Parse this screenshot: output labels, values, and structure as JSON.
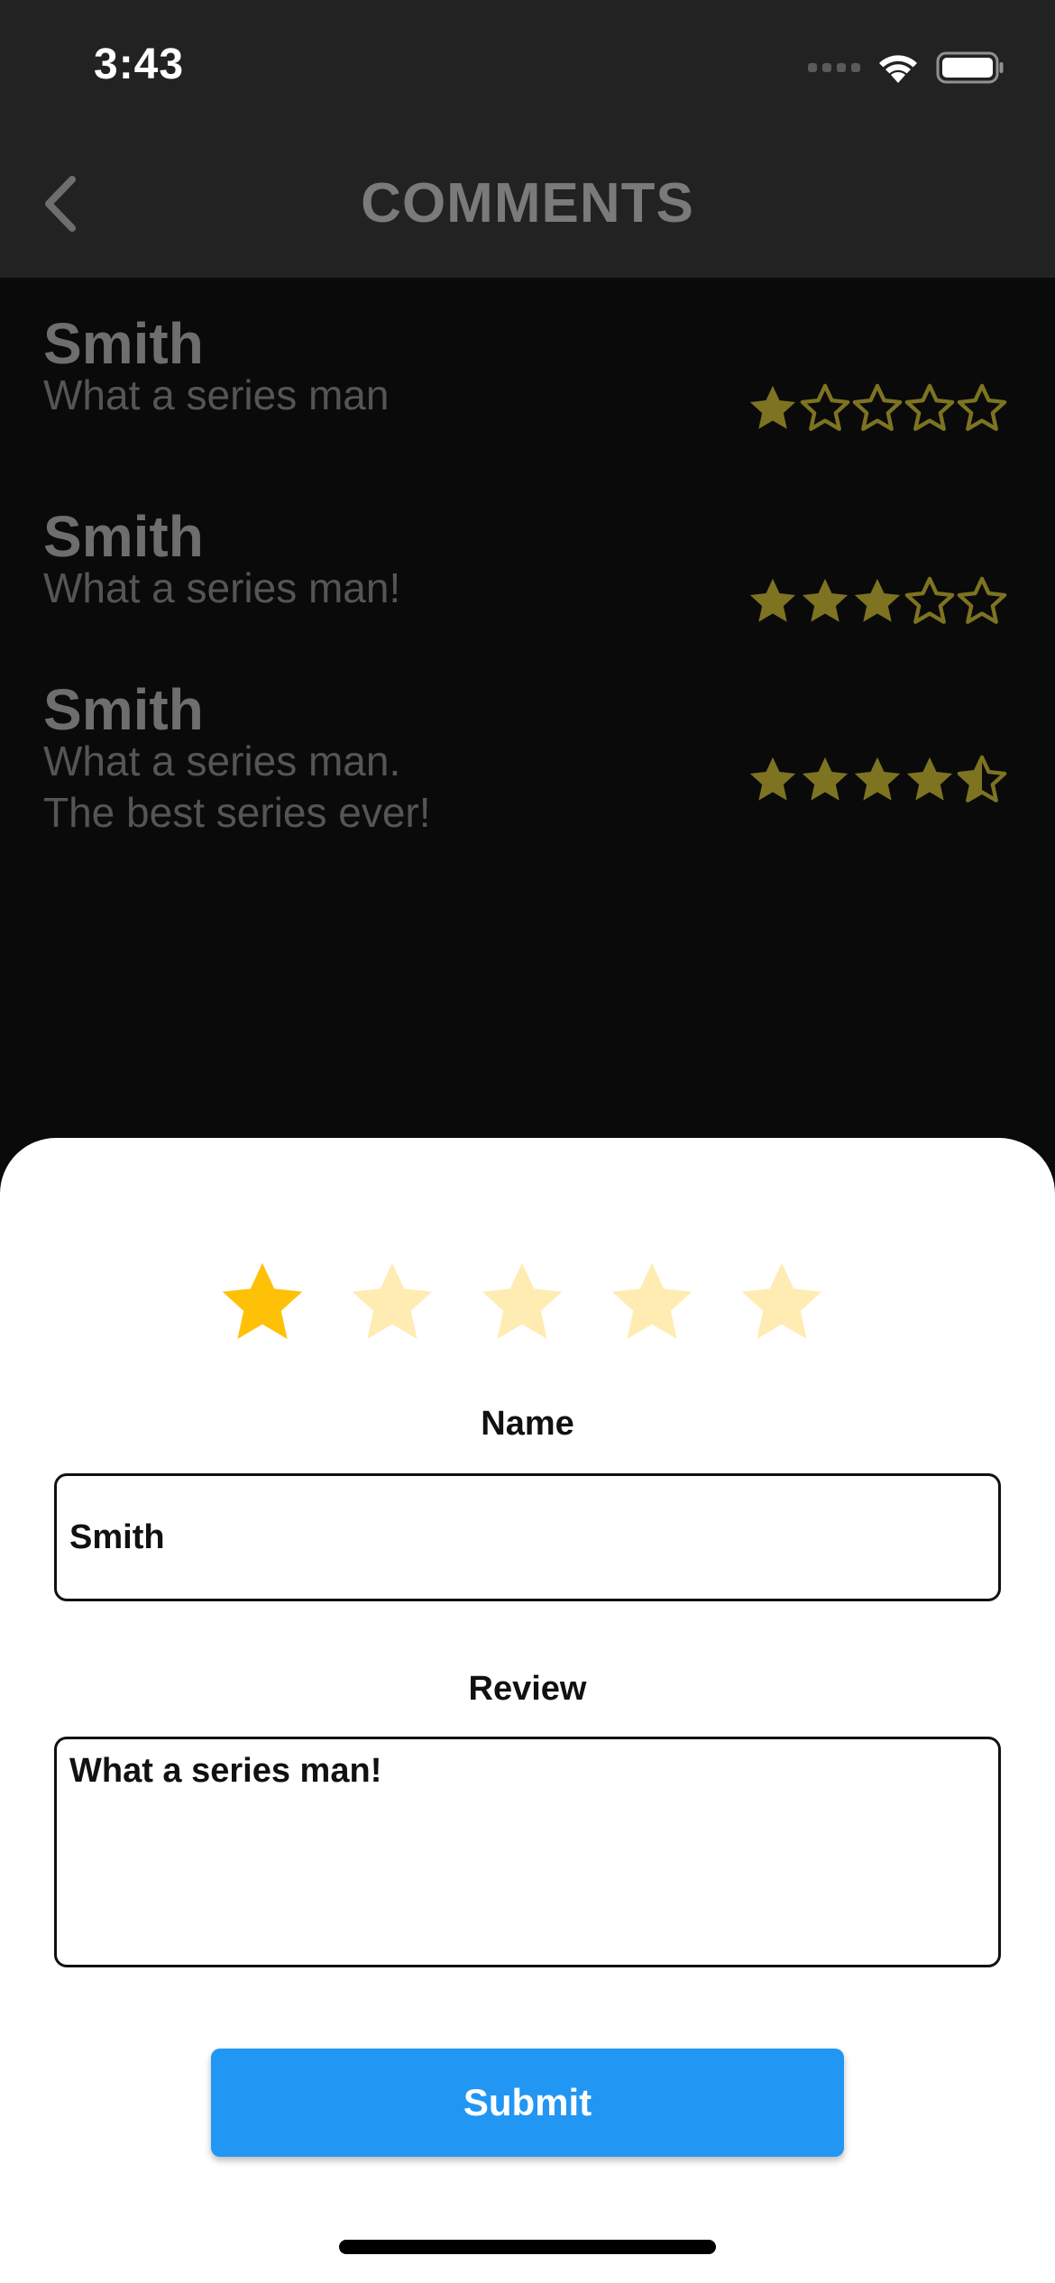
{
  "status_bar": {
    "time": "3:43",
    "icons": [
      "cellular-signal-icon",
      "wifi-icon",
      "battery-icon"
    ]
  },
  "nav": {
    "title": "COMMENTS",
    "back_icon": "chevron-left-icon"
  },
  "comments": [
    {
      "name": "Smith",
      "lines": [
        "What a series man"
      ],
      "rating": 1
    },
    {
      "name": "Smith",
      "lines": [
        "What a series man!"
      ],
      "rating": 3
    },
    {
      "name": "Smith",
      "lines": [
        "What a series man.",
        "The best  series ever!"
      ],
      "rating": 4.5
    }
  ],
  "form": {
    "selected_rating": 1,
    "max_rating": 5,
    "name_label": "Name",
    "name_value": "Smith",
    "review_label": "Review",
    "review_value": "What a series man!",
    "submit_label": "Submit"
  },
  "colors": {
    "star_dim": "#7d7321",
    "star_active": "#ffc107",
    "star_inactive": "#ffecb3",
    "submit": "#2196f3",
    "bar_background": "#222222",
    "list_background": "#0a0a0a"
  }
}
